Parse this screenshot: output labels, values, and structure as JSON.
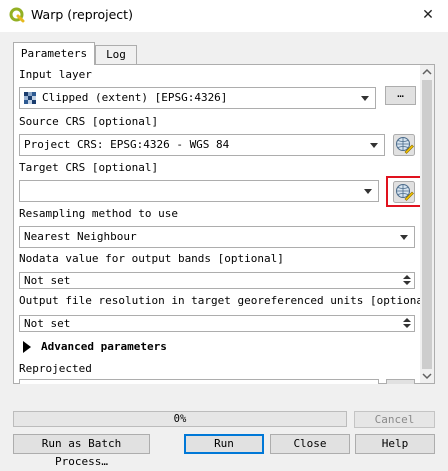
{
  "window": {
    "title": "Warp (reproject)",
    "close_glyph": "✕",
    "app_icon": "qgis-logo-icon"
  },
  "tabs": [
    {
      "label": "Parameters",
      "active": true
    },
    {
      "label": "Log",
      "active": false
    }
  ],
  "params": {
    "input_layer": {
      "label": "Input layer",
      "value": "Clipped (extent) [EPSG:4326]",
      "browse_label": "…"
    },
    "source_crs": {
      "label": "Source CRS [optional]",
      "value": "Project CRS: EPSG:4326 - WGS 84"
    },
    "target_crs": {
      "label": "Target CRS [optional]",
      "value": ""
    },
    "resampling": {
      "label": "Resampling method to use",
      "value": "Nearest Neighbour"
    },
    "nodata": {
      "label": "Nodata value for output bands [optional]",
      "value": "Not set"
    },
    "resolution": {
      "label": "Output file resolution in target georeferenced units [optional]",
      "value": "Not set"
    },
    "advanced": {
      "label": "Advanced parameters"
    },
    "reprojected": {
      "label": "Reprojected"
    }
  },
  "footer": {
    "progress": {
      "text": "0%",
      "fraction": 0
    },
    "cancel_label": "Cancel",
    "batch_label": "Run as Batch Process…",
    "run_label": "Run",
    "close_label": "Close",
    "help_label": "Help"
  },
  "colors": {
    "highlight": "#e0121e",
    "qgis_green": "#93b023"
  }
}
